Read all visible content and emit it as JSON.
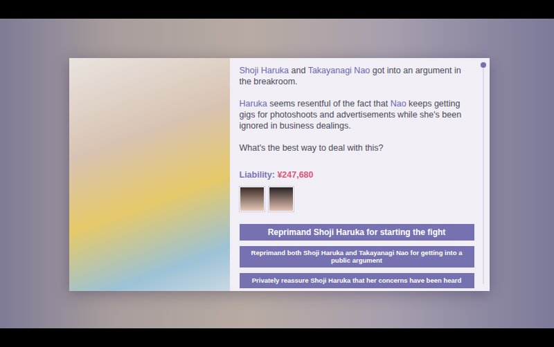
{
  "event": {
    "paragraphs": [
      [
        {
          "text": "Shoji Haruka",
          "highlight": true
        },
        {
          "text": " and ",
          "highlight": false
        },
        {
          "text": "Takayanagi Nao",
          "highlight": true
        },
        {
          "text": " got into an argument in the breakroom.",
          "highlight": false
        }
      ],
      [
        {
          "text": "Haruka",
          "highlight": true
        },
        {
          "text": " seems resentful of the fact that ",
          "highlight": false
        },
        {
          "text": "Nao",
          "highlight": true
        },
        {
          "text": " keeps getting gigs for photoshoots and advertisements while she's been ignored in business dealings.",
          "highlight": false
        }
      ],
      [
        {
          "text": "What's the best way to deal with this?",
          "highlight": false
        }
      ]
    ],
    "liability": {
      "label": "Liability: ",
      "value": "¥247,680"
    },
    "scroll": {
      "level": 0
    },
    "choices": [
      {
        "label": "Reprimand Shoji Haruka for starting the fight",
        "size": "large"
      },
      {
        "label": "Reprimand both Shoji Haruka and Takayanagi Nao for getting into a public argument",
        "size": "small"
      },
      {
        "label": "Privately reassure Shoji Haruka that her concerns have been heard",
        "size": "small"
      }
    ]
  }
}
